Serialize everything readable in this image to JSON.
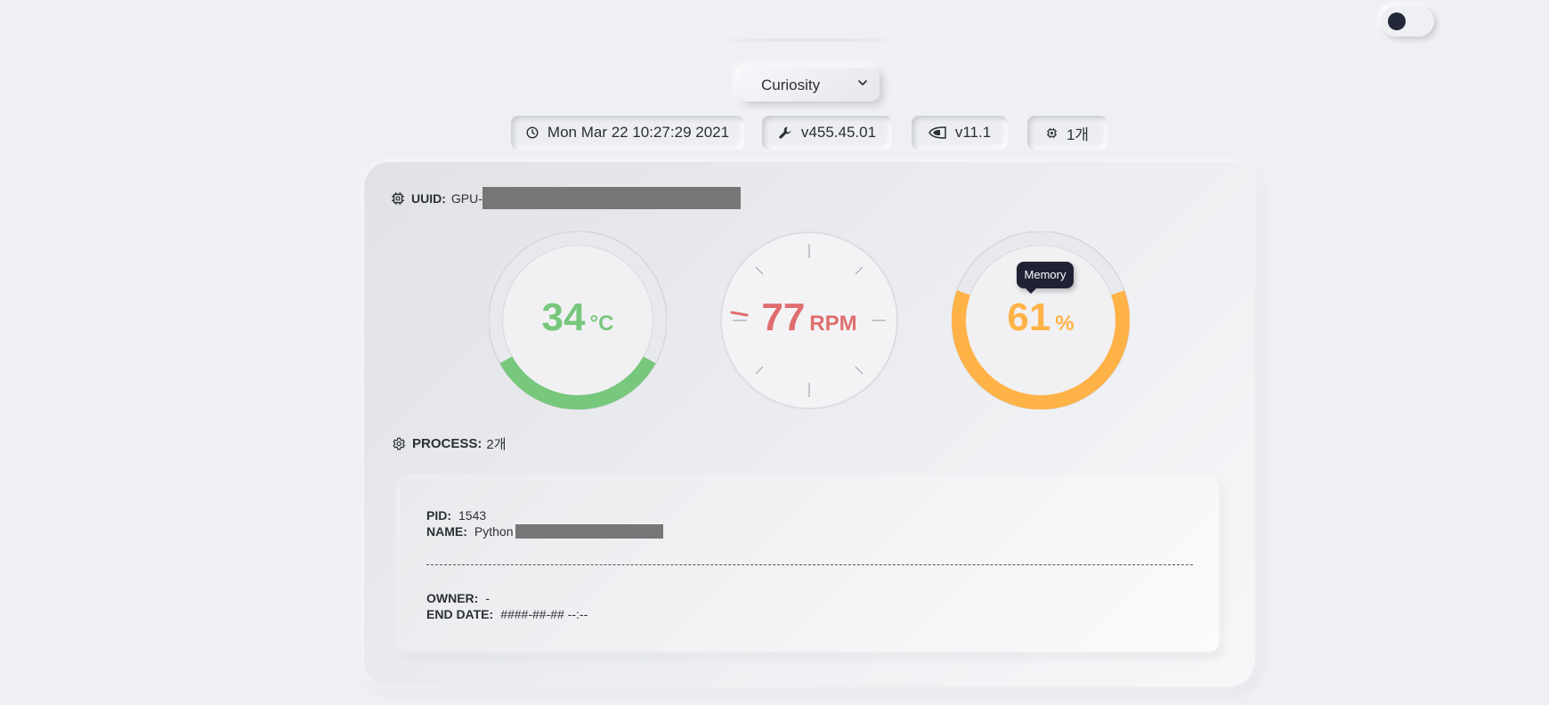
{
  "theme_toggle": {
    "state": "dark-off"
  },
  "gpu_select": {
    "value": "Curiosity"
  },
  "chips": {
    "datetime": {
      "icon": "clock-icon",
      "text": "Mon Mar 22 10:27:29 2021"
    },
    "driver": {
      "icon": "wrench-icon",
      "text": "v455.45.01"
    },
    "cuda": {
      "icon": "nvidia-icon",
      "text": "v11.1"
    },
    "gpu_count": {
      "icon": "chip-icon",
      "text": "1개"
    }
  },
  "gpu": {
    "uuid_label": "UUID:",
    "uuid_prefix": "GPU-",
    "gauges": {
      "temperature": {
        "value": "34",
        "unit": "°C",
        "fraction": 0.34,
        "color": "#77c77c"
      },
      "fan": {
        "value": "77",
        "unit": "RPM",
        "color": "#e06e6e"
      },
      "memory": {
        "value": "61",
        "unit": "%",
        "fraction": 0.61,
        "color": "#ffb347",
        "tooltip": "Memory"
      }
    },
    "process_label": "PROCESS:",
    "process_count": "2개"
  },
  "process": {
    "pid_label": "PID:",
    "pid": "1543",
    "name_label": "NAME:",
    "name": "Python",
    "owner_label": "OWNER:",
    "owner": "-",
    "end_date_label": "END DATE:",
    "end_date": "####-##-## --:--"
  }
}
